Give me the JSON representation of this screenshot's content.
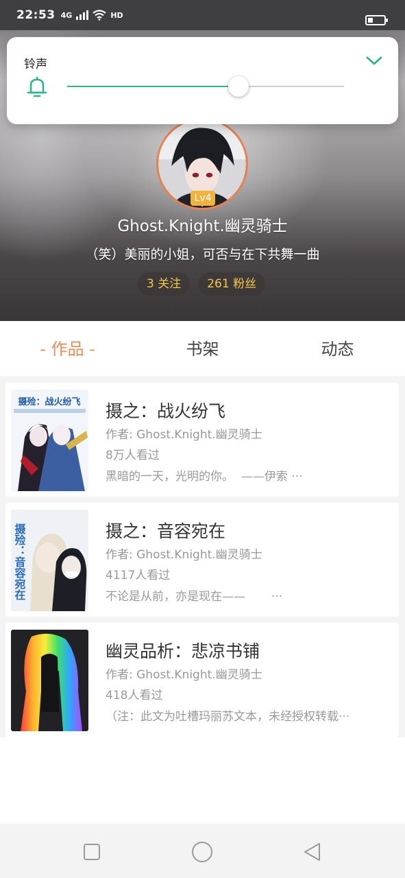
{
  "status_bar": {
    "time": "22:53",
    "network_tag": "4G",
    "hd_tag": "HD",
    "battery_level": 0.25
  },
  "volume_panel": {
    "label": "铃声",
    "level": 0.62,
    "accent_color": "#2eb48a",
    "icon": "bell-icon",
    "collapse_icon": "chevron-down-icon"
  },
  "profile": {
    "level": "Lv4",
    "name": "Ghost.Knight.幽灵骑士",
    "bio": "（笑）美丽的小姐，可否与在下共舞一曲",
    "following": "3 关注",
    "followers": "261 粉丝",
    "avatar_ring_color": "#e9824f"
  },
  "tabs": [
    {
      "label": "- 作品 -",
      "active": true
    },
    {
      "label": "书架",
      "active": false
    },
    {
      "label": "动态",
      "active": false
    }
  ],
  "works": [
    {
      "title": "摄之：战火纷飞",
      "author": "作者: Ghost.Knight.幽灵骑士",
      "views": "8万人看过",
      "desc": "黑暗的一天，光明的你。  ——伊索 ···",
      "cover_text": "摄殓：战火纷飞"
    },
    {
      "title": "摄之：音容宛在",
      "author": "作者: Ghost.Knight.幽灵骑士",
      "views": "4117人看过",
      "desc": "不论是从前，亦是现在——       ···",
      "cover_text": "摄殓：音容宛在"
    },
    {
      "title": "幽灵品析：悲凉书铺",
      "author": "作者: Ghost.Knight.幽灵骑士",
      "views": "418人看过",
      "desc": "（注：此文为吐槽玛丽苏文本，未经授权转载···",
      "cover_text": ""
    }
  ],
  "nav": {
    "recents": "square-icon",
    "home": "circle-icon",
    "back": "triangle-back-icon"
  },
  "colors": {
    "accent_orange": "#ec8a58",
    "stat_text": "#f5c84a",
    "badge": "#f0b33f"
  }
}
